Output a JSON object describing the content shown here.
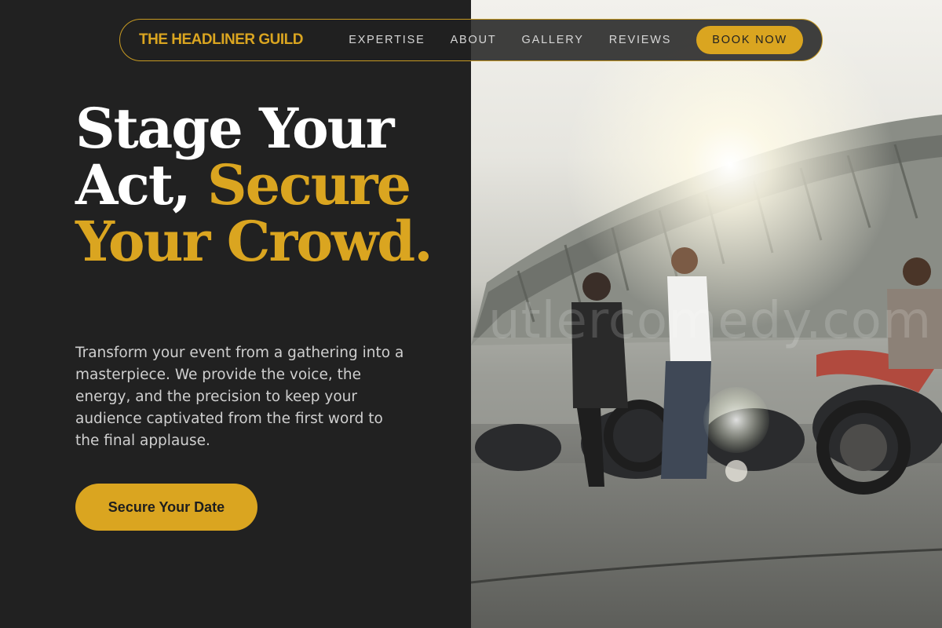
{
  "nav": {
    "brand": "THE HEADLINER GUILD",
    "links": [
      "EXPERTISE",
      "ABOUT",
      "GALLERY",
      "REVIEWS"
    ],
    "book_label": "BOOK NOW"
  },
  "hero": {
    "headline_white": "Stage Your Act, ",
    "headline_gold": "Secure Your Crowd.",
    "subtext": "Transform your event from a gathering into a masterpiece. We provide the voice, the energy, and the precision to keep your audience captivated from the first word to the final applause.",
    "cta_label": "Secure Your Date"
  },
  "photo": {
    "watermark": "utlercomedy.com"
  },
  "colors": {
    "background": "#212121",
    "accent": "#daa520",
    "text": "#ffffff",
    "muted_text": "#cfcfcf"
  }
}
